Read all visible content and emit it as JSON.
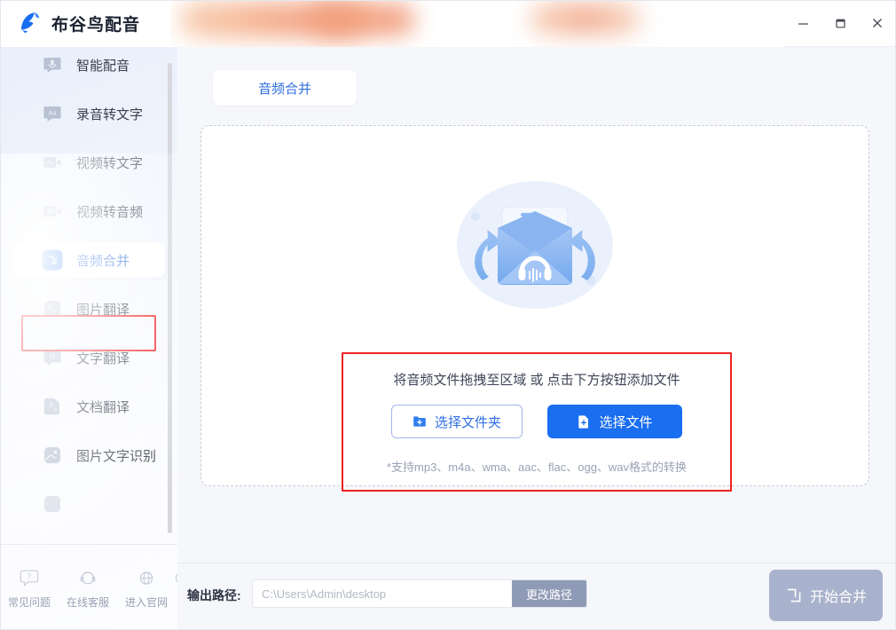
{
  "window": {
    "app_title": "布谷鸟配音",
    "minimize_label": "–",
    "maximize_label": "□",
    "close_label": "×"
  },
  "sidebar": {
    "items": [
      {
        "label": "智能配音",
        "icon": "mic-bubble-icon",
        "active": false
      },
      {
        "label": "录音转文字",
        "icon": "aa-bubble-icon",
        "active": false
      },
      {
        "label": "视频转文字",
        "icon": "aa-video-icon",
        "active": false
      },
      {
        "label": "视频转音频",
        "icon": "waveform-video-icon",
        "active": false
      },
      {
        "label": "音频合并",
        "icon": "merge-icon",
        "active": true
      },
      {
        "label": "图片翻译",
        "icon": "image-translate-icon",
        "active": false
      },
      {
        "label": "文字翻译",
        "icon": "text-translate-bubble-icon",
        "active": false
      },
      {
        "label": "文档翻译",
        "icon": "doc-translate-icon",
        "active": false
      },
      {
        "label": "图片文字识别",
        "icon": "image-ocr-icon",
        "active": false
      }
    ],
    "footer": [
      {
        "label": "常见问题",
        "icon": "question-bubble-icon"
      },
      {
        "label": "在线客服",
        "icon": "headset-icon"
      },
      {
        "label": "进入官网",
        "icon": "globe-icon"
      }
    ]
  },
  "main": {
    "tabs": [
      {
        "label": "音频合并",
        "active": true
      }
    ],
    "dropzone": {
      "illustration": "audio-merge-illustration",
      "hint": "将音频文件拖拽至区域 或 点击下方按钮添加文件",
      "choose_folder_label": "选择文件夹",
      "choose_file_label": "选择文件",
      "formats_prefix": "*支持",
      "formats": "mp3、m4a、wma、aac、flac、ogg、wav",
      "formats_suffix": "格式的转换",
      "formats_note": "*支持mp3、m4a、wma、aac、flac、ogg、wav格式的转换"
    }
  },
  "bottom": {
    "output_path_label": "输出路径:",
    "output_path_value": "",
    "output_path_placeholder": "C:\\Users\\Admin\\desktop",
    "change_path_label": "更改路径",
    "start_label": "开始合并"
  },
  "colors": {
    "accent": "#1a6ef0",
    "accent_text": "#2f6fe0",
    "annotation": "#ee2222",
    "muted": "#9aa3b4",
    "disabled_button": "#a9b2cc",
    "secondary_button": "#8f9bb6"
  }
}
